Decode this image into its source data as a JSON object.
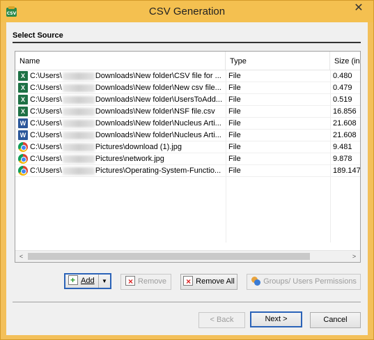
{
  "window": {
    "title": "CSV Generation",
    "close_glyph": "✕"
  },
  "section": {
    "label": "Select Source"
  },
  "table": {
    "columns": [
      "Name",
      "Type",
      "Size (in"
    ],
    "rows": [
      {
        "icon": "excel-icon",
        "prefix": "C:\\Users\\",
        "suffix": "Downloads\\New folder\\CSV file for ...",
        "type": "File",
        "size": "0.480"
      },
      {
        "icon": "excel-icon",
        "prefix": "C:\\Users\\",
        "suffix": "Downloads\\New folder\\New csv file...",
        "type": "File",
        "size": "0.479"
      },
      {
        "icon": "excel-icon",
        "prefix": "C:\\Users\\",
        "suffix": "Downloads\\New folder\\UsersToAdd...",
        "type": "File",
        "size": "0.519"
      },
      {
        "icon": "excel-icon",
        "prefix": "C:\\Users\\",
        "suffix": "Downloads\\New folder\\NSF file.csv",
        "type": "File",
        "size": "16.856"
      },
      {
        "icon": "word-icon",
        "prefix": "C:\\Users\\",
        "suffix": "Downloads\\New folder\\Nucleus Arti...",
        "type": "File",
        "size": "21.608"
      },
      {
        "icon": "word-icon",
        "prefix": "C:\\Users\\",
        "suffix": "Downloads\\New folder\\Nucleus Arti...",
        "type": "File",
        "size": "21.608"
      },
      {
        "icon": "chrome-icon",
        "prefix": "C:\\Users\\",
        "suffix": "Pictures\\download (1).jpg",
        "type": "File",
        "size": "9.481"
      },
      {
        "icon": "chrome-icon",
        "prefix": "C:\\Users\\",
        "suffix": "Pictures\\network.jpg",
        "type": "File",
        "size": "9.878"
      },
      {
        "icon": "chrome-icon",
        "prefix": "C:\\Users\\",
        "suffix": "Pictures\\Operating-System-Functio...",
        "type": "File",
        "size": "189.147"
      }
    ]
  },
  "buttons": {
    "add": "Add",
    "remove": "Remove",
    "remove_all": "Remove All",
    "groups": "Groups/ Users Permissions",
    "back": "< Back",
    "next": "Next >",
    "cancel": "Cancel"
  },
  "glyphs": {
    "scroll_left": "<",
    "scroll_right": ">",
    "dropdown": "▼"
  },
  "colors": {
    "title_bar": "#f4c050",
    "focus_border": "#2b63b8"
  }
}
